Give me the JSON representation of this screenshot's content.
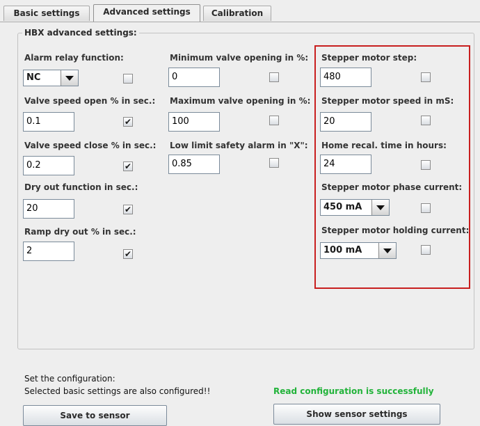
{
  "tabs": [
    "Basic settings",
    "Advanced settings",
    "Calibration"
  ],
  "group_title": "HBX advanced settings:",
  "col1": {
    "alarm_label": "Alarm relay function:",
    "alarm_value": "NC",
    "vso_label": "Valve speed open % in sec.:",
    "vso_value": "0.1",
    "vsc_label": "Valve speed close % in sec.:",
    "vsc_value": "0.2",
    "dry_label": "Dry out function in sec.:",
    "dry_value": "20",
    "ramp_label": "Ramp dry out % in sec.:",
    "ramp_value": "2"
  },
  "col2": {
    "min_label": "Minimum valve opening in %:",
    "min_value": "0",
    "max_label": "Maximum valve opening in %:",
    "max_value": "100",
    "low_label": "Low limit safety alarm in \"X\":",
    "low_value": "0.85"
  },
  "col3": {
    "step_label": "Stepper motor step:",
    "step_value": "480",
    "speed_label": "Stepper motor speed in mS:",
    "speed_value": "20",
    "home_label": "Home recal. time in hours:",
    "home_value": "24",
    "phase_label": "Stepper motor phase current:",
    "phase_value": "450 mA",
    "hold_label": "Stepper motor holding current:",
    "hold_value": "100 mA"
  },
  "checkmark": "✔",
  "footer": {
    "line1": "Set the configuration:",
    "line2": "Selected basic settings are also configured!!",
    "status": "Read configuration is successfully",
    "save_button": "Save to sensor",
    "show_button": "Show sensor settings"
  },
  "colors": {
    "status_green": "#22b33a",
    "highlight_red": "#c81e1e"
  }
}
